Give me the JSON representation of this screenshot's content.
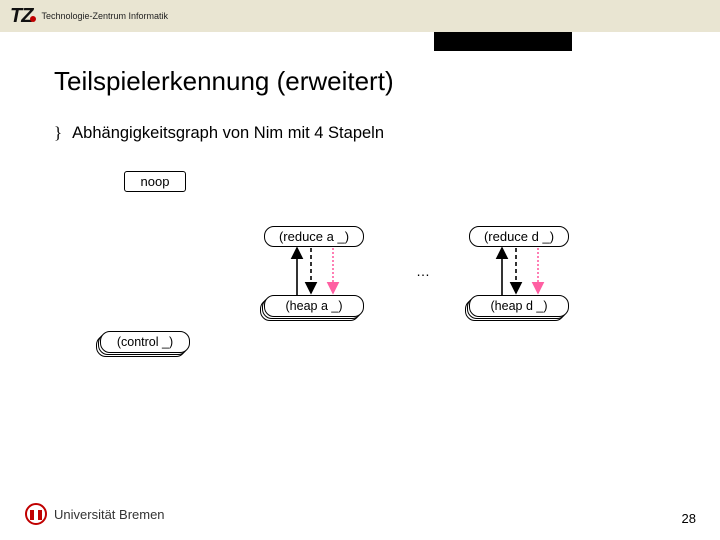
{
  "header": {
    "org_short": "TZ",
    "org_sub": "Technologie-Zentrum Informatik"
  },
  "title": "Teilspielerkennung (erweitert)",
  "bullet": "Abhängigkeitsgraph von Nim mit 4 Stapeln",
  "diagram": {
    "noop": "noop",
    "reduce_a": "(reduce a _)",
    "reduce_d": "(reduce d _)",
    "heap_a": "(heap a _)",
    "heap_d": "(heap d _)",
    "control": "(control _)",
    "ellipsis": "…"
  },
  "footer": {
    "university": "Universität Bremen",
    "page": "28"
  },
  "colors": {
    "accent_red": "#c00000",
    "arrow_pink": "#ff5fa2",
    "top_strip": "#e9e5d2"
  }
}
